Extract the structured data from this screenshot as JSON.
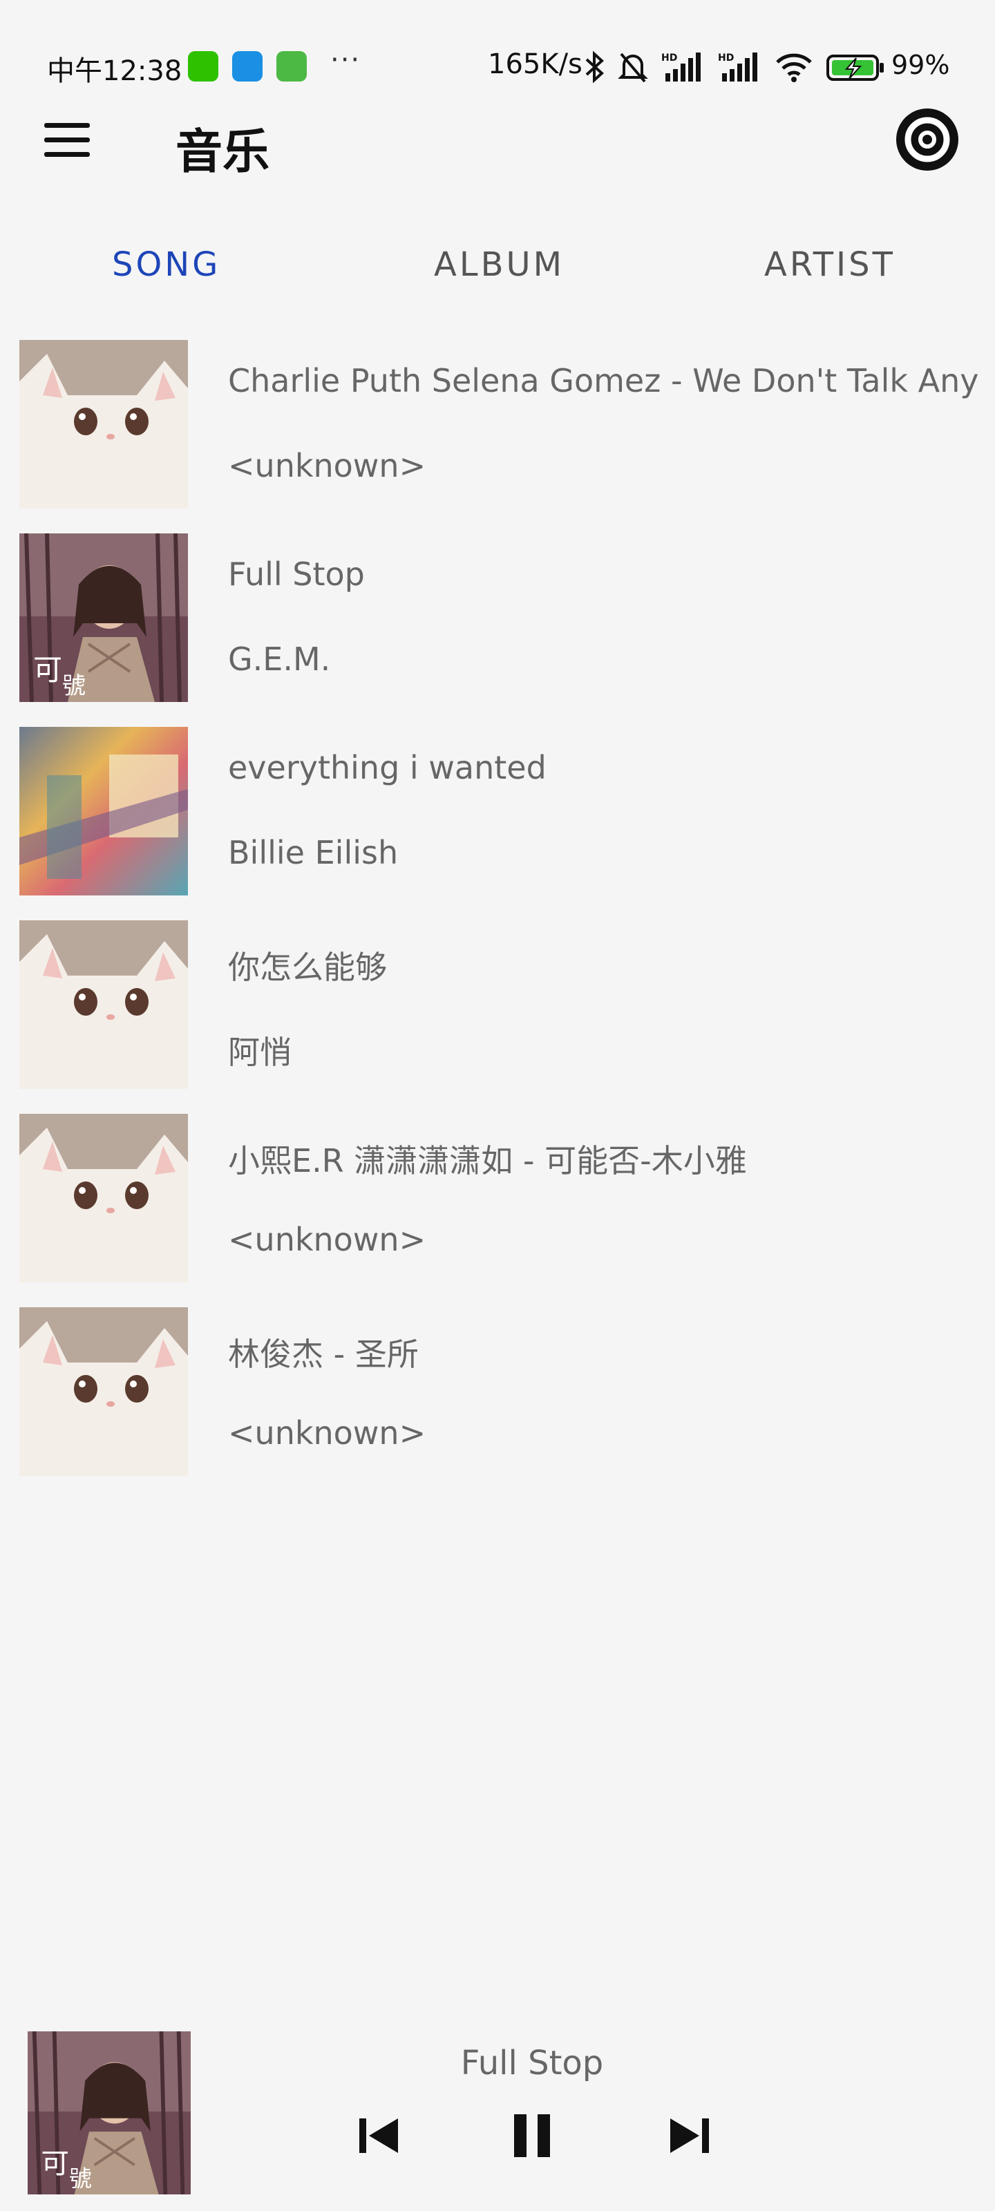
{
  "status_bar": {
    "time": "中午12:38",
    "more": "···",
    "net_speed": "165K/s",
    "battery_pct": "99%"
  },
  "app_bar": {
    "title": "音乐",
    "menu_icon": "menu-icon",
    "action_icon": "target-icon"
  },
  "tabs": [
    {
      "label": "SONG",
      "active": true
    },
    {
      "label": "ALBUM",
      "active": false
    },
    {
      "label": "ARTIST",
      "active": false
    }
  ],
  "songs": [
    {
      "title": "Charlie Puth Selena Gomez - We Don't Talk Any",
      "artist": "<unknown>",
      "art": "cat"
    },
    {
      "title": "Full Stop",
      "artist": "G.E.M.",
      "art": "gem"
    },
    {
      "title": "everything i wanted",
      "artist": "Billie Eilish",
      "art": "abstract"
    },
    {
      "title": "你怎么能够",
      "artist": "阿悄",
      "art": "cat"
    },
    {
      "title": "小熙E.R 潇潇潇潇如 - 可能否-木小雅",
      "artist": "<unknown>",
      "art": "cat"
    },
    {
      "title": "林俊杰 - 圣所",
      "artist": "<unknown>",
      "art": "cat"
    }
  ],
  "player": {
    "title": "Full Stop",
    "art": "gem",
    "controls": [
      "previous-icon",
      "pause-icon",
      "next-icon"
    ]
  },
  "colors": {
    "background": "#f5f5f5",
    "tab_active": "#1d45b8",
    "tab_inactive": "#555555",
    "text_secondary": "#666666"
  }
}
